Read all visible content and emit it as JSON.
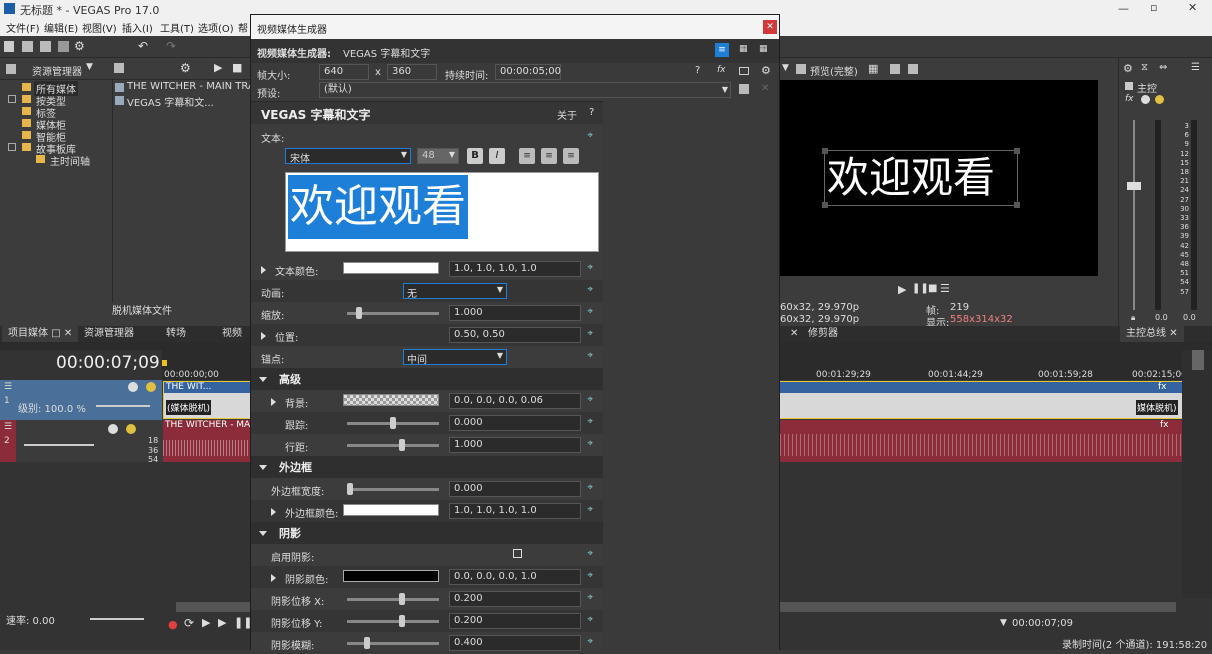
{
  "app": {
    "title": "无标题 * - VEGAS Pro 17.0",
    "menu": [
      "文件(F)",
      "编辑(E)",
      "视图(V)",
      "插入(I)",
      "工具(T)",
      "选项(O)",
      "帮"
    ]
  },
  "explorer": {
    "title": "资源管理器",
    "tree": [
      "所有媒体",
      "按类型",
      "标签",
      "媒体柜",
      "智能柜",
      "故事板库",
      "主时间轴"
    ],
    "files": [
      "THE WITCHER - MAIN TRAIL",
      "VEGAS 字幕和文..."
    ],
    "footer": "脱机媒体文件",
    "tabs": [
      "项目媒体",
      "资源管理器",
      "转场",
      "视频 F"
    ]
  },
  "dialog": {
    "window_title": "视频媒体生成器",
    "header_label": "视频媒体生成器:",
    "header_value": "VEGAS 字幕和文字",
    "frame_size_label": "帧大小:",
    "frame_w": "640",
    "frame_x": "x",
    "frame_h": "360",
    "duration_label": "持续时间:",
    "duration": "00:00:05;00",
    "preset_label": "预设:",
    "preset": "(默认)",
    "plugin_title": "VEGAS 字幕和文字",
    "about": "关于",
    "help": "?",
    "text_label": "文本:",
    "font": "宋体",
    "font_size": "48",
    "bold": "B",
    "italic": "I",
    "text": "欢迎观看",
    "text_color_label": "文本颜色:",
    "text_color": "1.0, 1.0, 1.0, 1.0",
    "animation_label": "动画:",
    "animation": "无",
    "scale_label": "缩放:",
    "scale": "1.000",
    "position_label": "位置:",
    "position": "0.50, 0.50",
    "anchor_label": "锚点:",
    "anchor": "中间",
    "advanced_label": "高级",
    "background_label": "背景:",
    "background": "0.0, 0.0, 0.0, 0.06",
    "tracking_label": "跟踪:",
    "tracking": "0.000",
    "line_spacing_label": "行距:",
    "line_spacing": "1.000",
    "outline_label": "外边框",
    "outline_width_label": "外边框宽度:",
    "outline_width": "0.000",
    "outline_color_label": "外边框颜色:",
    "outline_color": "1.0, 1.0, 1.0, 1.0",
    "shadow_label": "阴影",
    "shadow_enable_label": "启用阴影:",
    "shadow_color_label": "阴影颜色:",
    "shadow_color": "0.0, 0.0, 0.0, 1.0",
    "shadow_x_label": "阴影位移 X:",
    "shadow_x": "0.200",
    "shadow_y_label": "阴影位移 Y:",
    "shadow_y": "0.200",
    "shadow_blur_label": "阴影模糊:",
    "shadow_blur": "0.400",
    "values": {
      "scale": 0.1,
      "tracking": 0.5,
      "line_spacing": 0.6,
      "outline_width": 0.0,
      "shadow_x": 0.6,
      "shadow_y": 0.6,
      "shadow_blur": 0.2
    }
  },
  "preview": {
    "label": "预览(完整)",
    "text": "欢迎观看",
    "info1": "60x32, 29.970p",
    "info2": "60x32, 29.970p",
    "frame_label": "帧:",
    "frame": "219",
    "display_label": "显示:",
    "display": "558x314x32",
    "tab": "修剪器"
  },
  "master": {
    "title": "主控",
    "scale": [
      "3",
      "6",
      "9",
      "12",
      "15",
      "18",
      "21",
      "24",
      "27",
      "30",
      "33",
      "36",
      "39",
      "42",
      "45",
      "48",
      "51",
      "54",
      "57"
    ],
    "val_l": "0.0",
    "val_r": "0.0",
    "tab": "主控总线"
  },
  "timeline": {
    "timecode": "00:00:07;09",
    "ruler": [
      "00:00:00;00",
      "00:01:29;29",
      "00:01:44;29",
      "00:01:59;28",
      "00:02:15;00"
    ],
    "level": "级别: 100.0 %",
    "track1_clip": "THE WIT...",
    "track1_sub": "(媒体脱机)",
    "track1_end": "媒体脱机)",
    "track2_clip": "THE WITCHER - MA",
    "db": [
      "18",
      "36",
      "54"
    ],
    "rate": "速率: 0.00",
    "cursor_time": "00:00:07;09",
    "record": "录制时间(2 个通道): 191:58:20"
  },
  "colors": {
    "accent": "#1e7fd8",
    "video_track": "#4a6f98",
    "audio_track": "#8c2b3a",
    "dialog_bg": "#3c3c3c"
  }
}
